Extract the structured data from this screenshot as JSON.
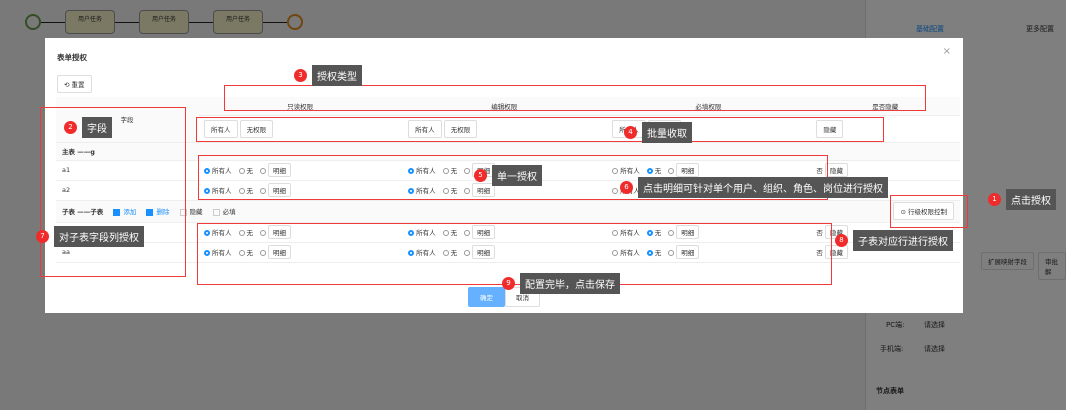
{
  "background": {
    "tasks": [
      "用户任务",
      "用户任务",
      "用户任务"
    ],
    "right_tabs": [
      "基础配置",
      "更多配置"
    ],
    "right_buttons": [
      "扩展映射字段",
      "审批解"
    ],
    "pc_label": "PC端:",
    "mobile_label": "手机端:",
    "select_placeholder": "请选择",
    "node_form": "节点表单"
  },
  "modal": {
    "title": "表单授权",
    "close": "×",
    "reset": "重置",
    "columns": [
      "字段",
      "只读权限",
      "编辑权限",
      "必填权限",
      "是否隐藏"
    ],
    "batch": {
      "all": "所有人",
      "none": "无权限",
      "hide": "隐藏"
    },
    "main_table": "主表 ——g",
    "sub_table": "子表 ——子表",
    "sub_opts": [
      "添加",
      "删除",
      "隐藏",
      "必填"
    ],
    "row_ctrl": "行级权限控制",
    "rows": [
      {
        "name": "a1",
        "section": "main"
      },
      {
        "name": "a2",
        "section": "main"
      },
      {
        "name": "",
        "section": "sub"
      },
      {
        "name": "aa",
        "section": "sub"
      }
    ],
    "opt_all": "所有人",
    "opt_none": "无",
    "opt_detail": "明细",
    "hide_no": "否",
    "hide_btn": "隐藏",
    "ok": "确定",
    "cancel": "取消"
  },
  "annotations": [
    {
      "n": "1",
      "text": "点击授权"
    },
    {
      "n": "2",
      "text": "字段"
    },
    {
      "n": "3",
      "text": "授权类型"
    },
    {
      "n": "4",
      "text": "批量收取"
    },
    {
      "n": "5",
      "text": "单一授权"
    },
    {
      "n": "6",
      "text": "点击明细可针对单个用户、组织、角色、岗位进行授权"
    },
    {
      "n": "7",
      "text": "对子表字段列授权"
    },
    {
      "n": "8",
      "text": "子表对应行进行授权"
    },
    {
      "n": "9",
      "text": "配置完毕，点击保存"
    }
  ]
}
